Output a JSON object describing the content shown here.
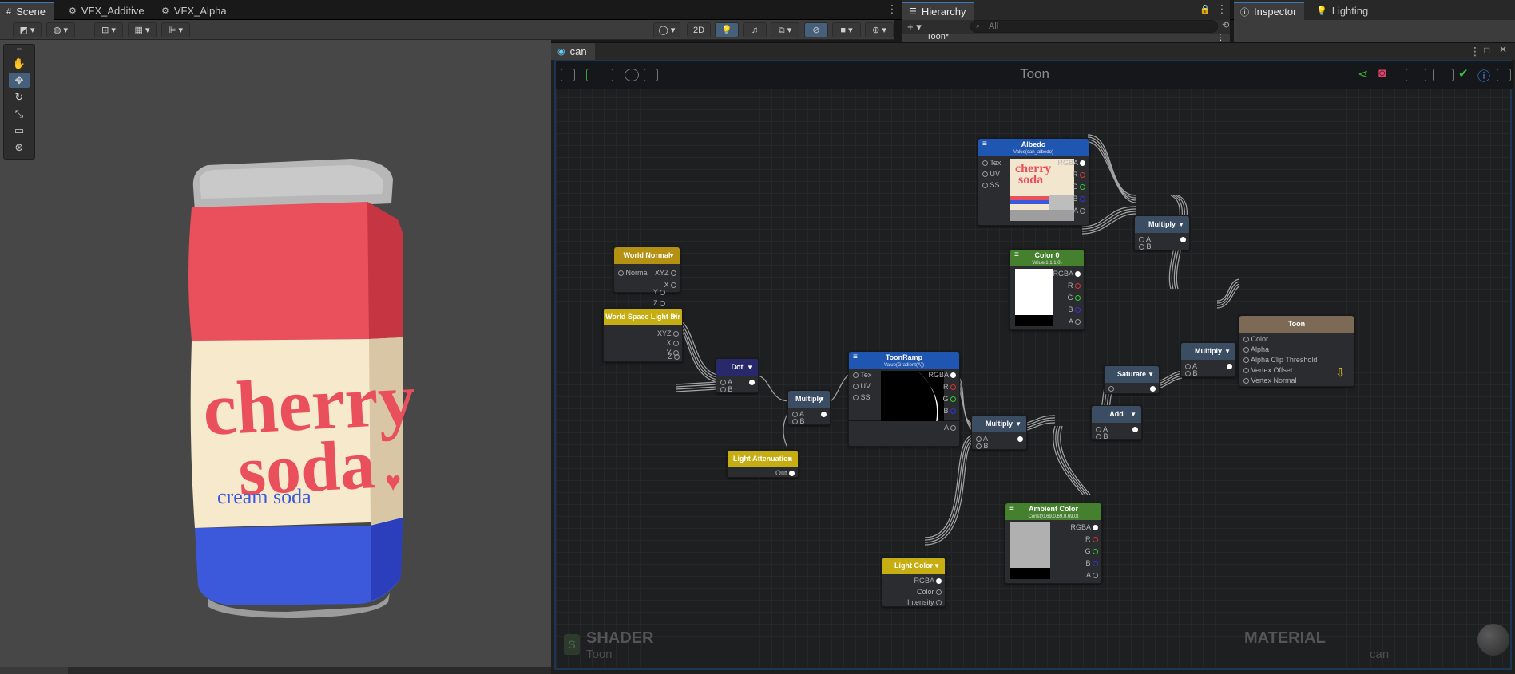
{
  "tabs": {
    "scene": "Scene",
    "vfx_additive": "VFX_Additive",
    "vfx_alpha": "VFX_Alpha",
    "hierarchy": "Hierarchy",
    "inspector": "Inspector",
    "lighting": "Lighting"
  },
  "scene_toolbar": {
    "mode_2d": "2D"
  },
  "hierarchy": {
    "search_placeholder": "All",
    "root_item": "Toon*"
  },
  "shader_graph": {
    "tab_label": "can",
    "title": "Toon",
    "bottom_left_label": "SHADER",
    "bottom_left_sub": "Toon",
    "bottom_right_label": "MATERIAL",
    "bottom_right_sub": "can"
  },
  "can_label": {
    "line1": "cherry",
    "line2": "soda",
    "line3": "cream soda"
  },
  "nodes": {
    "world_normal": {
      "title": "World Normal",
      "inputs": [
        "Normal"
      ],
      "outputs": [
        "XYZ",
        "X",
        "Y",
        "Z"
      ]
    },
    "world_space_light_dir": {
      "title": "World Space Light Dir",
      "outputs": [
        "XYZ",
        "X",
        "Y",
        "Z"
      ]
    },
    "dot": {
      "title": "Dot",
      "inputs": [
        "A",
        "B"
      ]
    },
    "multiply_1": {
      "title": "Multiply",
      "inputs": [
        "A",
        "B"
      ]
    },
    "light_attenuation": {
      "title": "Light Attenuation",
      "outputs": [
        "Out"
      ]
    },
    "toon_ramp": {
      "title": "ToonRamp",
      "subtitle": "Value(Gradient(A))",
      "inputs": [
        "Tex",
        "UV",
        "SS"
      ],
      "outputs": [
        "RGBA",
        "R",
        "G",
        "B",
        "A"
      ]
    },
    "multiply_2": {
      "title": "Multiply",
      "inputs": [
        "A",
        "B"
      ]
    },
    "light_color": {
      "title": "Light Color",
      "outputs": [
        "RGBA",
        "Color",
        "Intensity"
      ]
    },
    "add": {
      "title": "Add",
      "inputs": [
        "A",
        "B"
      ]
    },
    "ambient_color": {
      "title": "Ambient Color",
      "subtitle": "Const(0.69,0.69,0.69,0)",
      "outputs": [
        "RGBA",
        "R",
        "G",
        "B",
        "A"
      ]
    },
    "saturate": {
      "title": "Saturate"
    },
    "albedo": {
      "title": "Albedo",
      "subtitle": "Value(can_albedo)",
      "inputs": [
        "Tex",
        "UV",
        "SS"
      ],
      "outputs": [
        "RGBA",
        "R",
        "G",
        "B",
        "A"
      ]
    },
    "color0": {
      "title": "Color 0",
      "subtitle": "Value(1,1,1,0)",
      "outputs": [
        "RGBA",
        "R",
        "G",
        "B",
        "A"
      ]
    },
    "multiply_3": {
      "title": "Multiply",
      "inputs": [
        "A",
        "B"
      ]
    },
    "multiply_4": {
      "title": "Multiply",
      "inputs": [
        "A",
        "B"
      ]
    },
    "toon": {
      "title": "Toon",
      "inputs": [
        "Color",
        "Alpha",
        "Alpha Clip Threshold",
        "Vertex Offset",
        "Vertex Normal"
      ]
    }
  },
  "colors": {
    "accent_blue": "#3a79bb",
    "can_red": "#e9505c",
    "can_cream": "#f7e9cc",
    "can_blue": "#3c58db"
  }
}
